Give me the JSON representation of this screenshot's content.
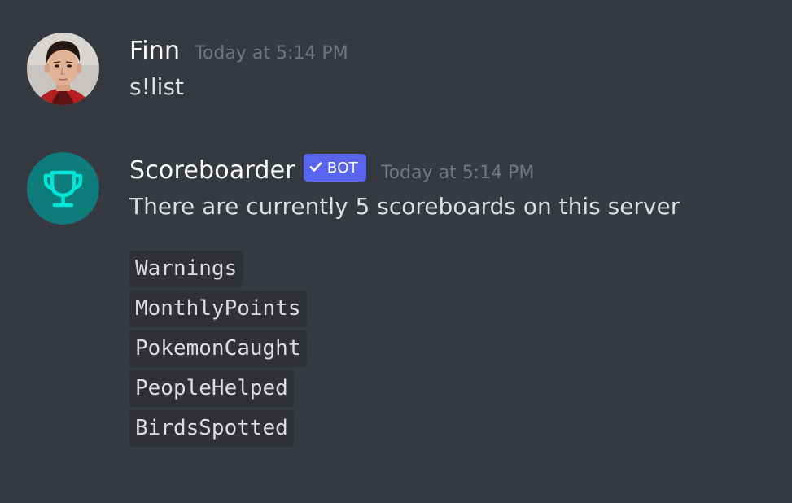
{
  "messages": [
    {
      "author": "Finn",
      "timestamp": "Today at 5:14 PM",
      "text": "s!list",
      "avatar": "user-photo-avatar"
    },
    {
      "author": "Scoreboarder",
      "badge": "BOT",
      "timestamp": "Today at 5:14 PM",
      "text": "There are currently 5 scoreboards on this server",
      "avatar": "trophy-icon",
      "avatar_color": "#0e7c7b",
      "codes": [
        "Warnings",
        "MonthlyPoints",
        "PokemonCaught",
        "PeopleHelped",
        "BirdsSpotted"
      ]
    }
  ],
  "colors": {
    "background": "#36393f",
    "code_background": "#2f3136",
    "bot_badge": "#5865f2",
    "trophy": "#00e5d8"
  }
}
